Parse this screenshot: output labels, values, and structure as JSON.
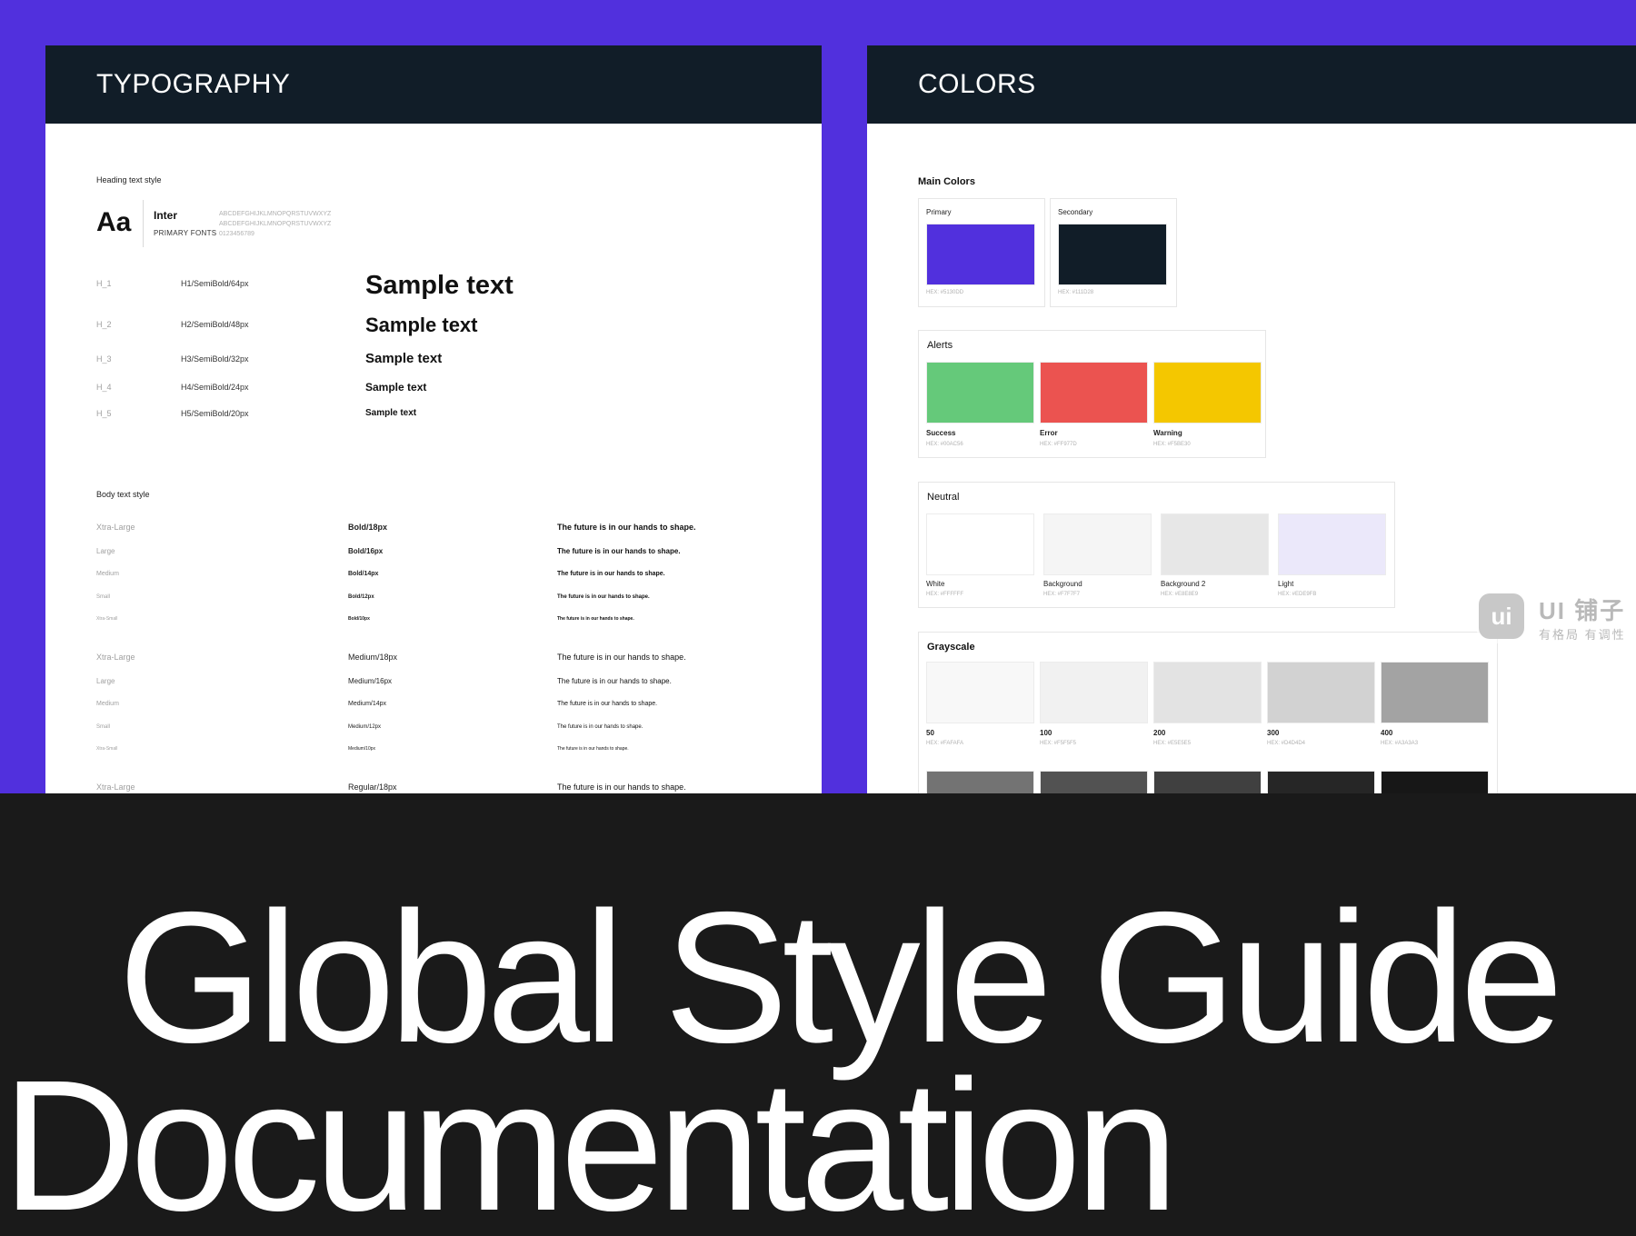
{
  "typography": {
    "header": "TYPOGRAPHY",
    "heading_section_label": "Heading text style",
    "font": {
      "sample": "Aa",
      "name": "Inter",
      "role": "PRIMARY FONTS",
      "upper": "ABCDEFGHIJKLMNOPQRSTUVWXYZ",
      "lower": "ABCDEFGHIJKLMNOPQRSTUVWXYZ",
      "digits": "0123456789"
    },
    "headings": [
      {
        "token": "H_1",
        "spec": "H1/SemiBold/64px",
        "sample": "Sample text"
      },
      {
        "token": "H_2",
        "spec": "H2/SemiBold/48px",
        "sample": "Sample text"
      },
      {
        "token": "H_3",
        "spec": "H3/SemiBold/32px",
        "sample": "Sample text"
      },
      {
        "token": "H_4",
        "spec": "H4/SemiBold/24px",
        "sample": "Sample text"
      },
      {
        "token": "H_5",
        "spec": "H5/SemiBold/20px",
        "sample": "Sample text"
      }
    ],
    "body_section_label": "Body text style",
    "body_rows": [
      {
        "size": "Xtra-Large",
        "spec": "Bold/18px",
        "sample": "The future is in our hands to shape."
      },
      {
        "size": "Large",
        "spec": "Bold/16px",
        "sample": "The future is in our hands to shape."
      },
      {
        "size": "Medium",
        "spec": "Bold/14px",
        "sample": "The future is in our hands to shape."
      },
      {
        "size": "Small",
        "spec": "Bold/12px",
        "sample": "The future is in our hands to shape."
      },
      {
        "size": "Xtra-Small",
        "spec": "Bold/10px",
        "sample": "The future is in our hands to shape."
      },
      {
        "size": "Xtra-Large",
        "spec": "Medium/18px",
        "sample": "The future is in our hands to shape."
      },
      {
        "size": "Large",
        "spec": "Medium/16px",
        "sample": "The future is in our hands to shape."
      },
      {
        "size": "Medium",
        "spec": "Medium/14px",
        "sample": "The future is in our hands to shape."
      },
      {
        "size": "Small",
        "spec": "Medium/12px",
        "sample": "The future is in our hands to shape."
      },
      {
        "size": "Xtra-Small",
        "spec": "Medium/10px",
        "sample": "The future is in our hands to shape."
      },
      {
        "size": "Xtra-Large",
        "spec": "Regular/18px",
        "sample": "The future is in our hands to shape."
      }
    ]
  },
  "colors": {
    "header": "COLORS",
    "main_title": "Main Colors",
    "main": [
      {
        "name": "Primary",
        "hex_label": "HEX: #5130DD",
        "color": "#5130DD"
      },
      {
        "name": "Secondary",
        "hex_label": "HEX: #111D28",
        "color": "#111D28"
      }
    ],
    "alerts_title": "Alerts",
    "alerts": [
      {
        "name": "Success",
        "hex_label": "HEX: #00AC56",
        "color": "#65C97A"
      },
      {
        "name": "Error",
        "hex_label": "HEX: #FF977D",
        "color": "#EB5350"
      },
      {
        "name": "Warning",
        "hex_label": "HEX: #F5BE30",
        "color": "#F4C700"
      }
    ],
    "neutral_title": "Neutral",
    "neutral": [
      {
        "name": "White",
        "hex_label": "HEX: #FFFFFF",
        "color": "#FFFFFF"
      },
      {
        "name": "Background",
        "hex_label": "HEX: #F7F7F7",
        "color": "#F5F5F5"
      },
      {
        "name": "Background 2",
        "hex_label": "HEX: #E8E8E9",
        "color": "#E7E7E7"
      },
      {
        "name": "Light",
        "hex_label": "HEX: #EDE9FB",
        "color": "#EBE8FA"
      }
    ],
    "grayscale_title": "Grayscale",
    "grayscale": [
      {
        "name": "50",
        "hex_label": "HEX: #FAFAFA",
        "color": "#F8F8F8"
      },
      {
        "name": "100",
        "hex_label": "HEX: #F5F5F5",
        "color": "#F1F1F1"
      },
      {
        "name": "200",
        "hex_label": "HEX: #E5E5E5",
        "color": "#E3E3E3"
      },
      {
        "name": "300",
        "hex_label": "HEX: #D4D4D4",
        "color": "#D2D2D2"
      },
      {
        "name": "400",
        "hex_label": "HEX: #A3A3A3",
        "color": "#A3A3A3"
      }
    ],
    "grayscale_row2": [
      "#737373",
      "#525252",
      "#404040",
      "#262626",
      "#171717"
    ]
  },
  "watermark": {
    "logo": "ui",
    "title": "UI 铺子",
    "subtitle": "有格局 有调性"
  },
  "hero": {
    "line1": "Global Style Guide",
    "line2": "Documentation"
  },
  "accent_colors": {
    "background": "#5130DD",
    "header": "#111D28",
    "bottom": "#1A1A1A"
  }
}
